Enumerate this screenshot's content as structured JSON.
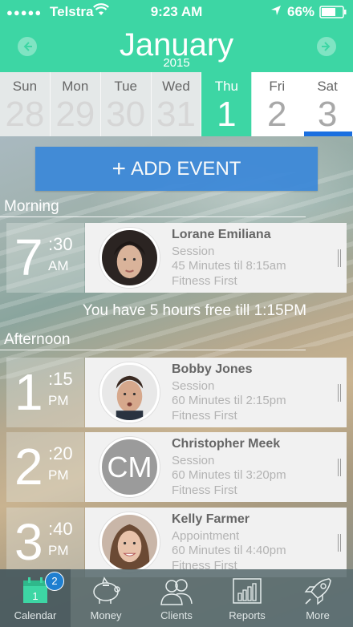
{
  "status": {
    "signal": "●●●●●",
    "carrier": "Telstra",
    "time": "9:23 AM",
    "battery": "66%"
  },
  "header": {
    "month": "January",
    "year": "2015",
    "prev_icon": "chevron-left-icon",
    "next_icon": "chevron-right-icon",
    "accent": "#3dd6a4"
  },
  "week": [
    {
      "name": "Sun",
      "num": "28"
    },
    {
      "name": "Mon",
      "num": "29"
    },
    {
      "name": "Tue",
      "num": "30"
    },
    {
      "name": "Wed",
      "num": "31"
    },
    {
      "name": "Thu",
      "num": "1"
    },
    {
      "name": "Fri",
      "num": "2"
    },
    {
      "name": "Sat",
      "num": "3"
    }
  ],
  "add_event": {
    "plus": "+",
    "label": "ADD EVENT"
  },
  "sections": {
    "morning": "Morning",
    "afternoon": "Afternoon"
  },
  "free_time": "You have 5 hours free till 1:15PM",
  "events": [
    {
      "hour": "7",
      "min": ":30",
      "ampm": "AM",
      "name": "Lorane Emiliana",
      "type": "Session",
      "duration": "45 Minutes til 8:15am",
      "location": "Fitness First"
    },
    {
      "hour": "1",
      "min": ":15",
      "ampm": "PM",
      "name": "Bobby Jones",
      "type": "Session",
      "duration": "60 Minutes til 2:15pm",
      "location": "Fitness First"
    },
    {
      "hour": "2",
      "min": ":20",
      "ampm": "PM",
      "name": "Christopher Meek",
      "initials": "CM",
      "type": "Session",
      "duration": "60 Minutes til 3:20pm",
      "location": "Fitness First"
    },
    {
      "hour": "3",
      "min": ":40",
      "ampm": "PM",
      "name": "Kelly Farmer",
      "type": "Appointment",
      "duration": "60 Minutes til 4:40pm",
      "location": "Fitness First"
    }
  ],
  "tabs": [
    {
      "label": "Calendar",
      "icon": "calendar-icon",
      "badge": "2",
      "cal_num": "1"
    },
    {
      "label": "Money",
      "icon": "piggy-bank-icon"
    },
    {
      "label": "Clients",
      "icon": "clients-icon"
    },
    {
      "label": "Reports",
      "icon": "bar-chart-icon"
    },
    {
      "label": "More",
      "icon": "rocket-icon"
    }
  ]
}
